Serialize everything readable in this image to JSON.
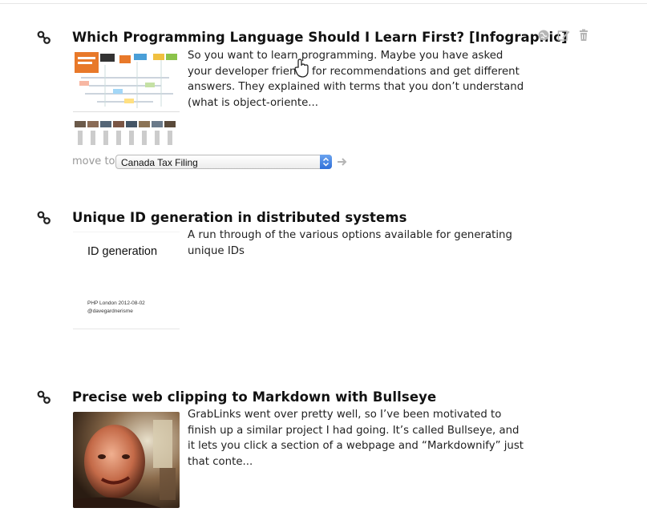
{
  "items": [
    {
      "title": "Which Programming Language Should I Learn First? [Infographic]",
      "excerpt": "So you want to learn programming. Maybe you have asked your developer friends for recommendations and get different answers. They explained with terms that you don’t understand (what is object-oriente...",
      "move_to_label": "move to",
      "move_to_value": "Canada Tax Filing",
      "thumbnail": "infographic-thumbnail",
      "actions": [
        "globe-icon",
        "edit-icon",
        "trash-icon"
      ]
    },
    {
      "title": "Unique ID generation in distributed systems",
      "excerpt": "A run through of the various options available for generating unique IDs",
      "thumb_title": "ID generation",
      "thumb_line1": "PHP London 2012-08-02",
      "thumb_line2": "@davegardnerisme"
    },
    {
      "title": "Precise web clipping to Markdown with Bullseye",
      "excerpt": "GrabLinks went over pretty well, so I’ve been motivated to finish up a similar project I had going. It’s called Bullseye, and it lets you click a section of a webpage and “Markdownify” just that conte...",
      "thumbnail": "portrait-photo"
    }
  ],
  "colors": {
    "accent_blue": "#2f6fd9",
    "muted_text": "#999999",
    "icon_gray": "#b5b5b5"
  }
}
